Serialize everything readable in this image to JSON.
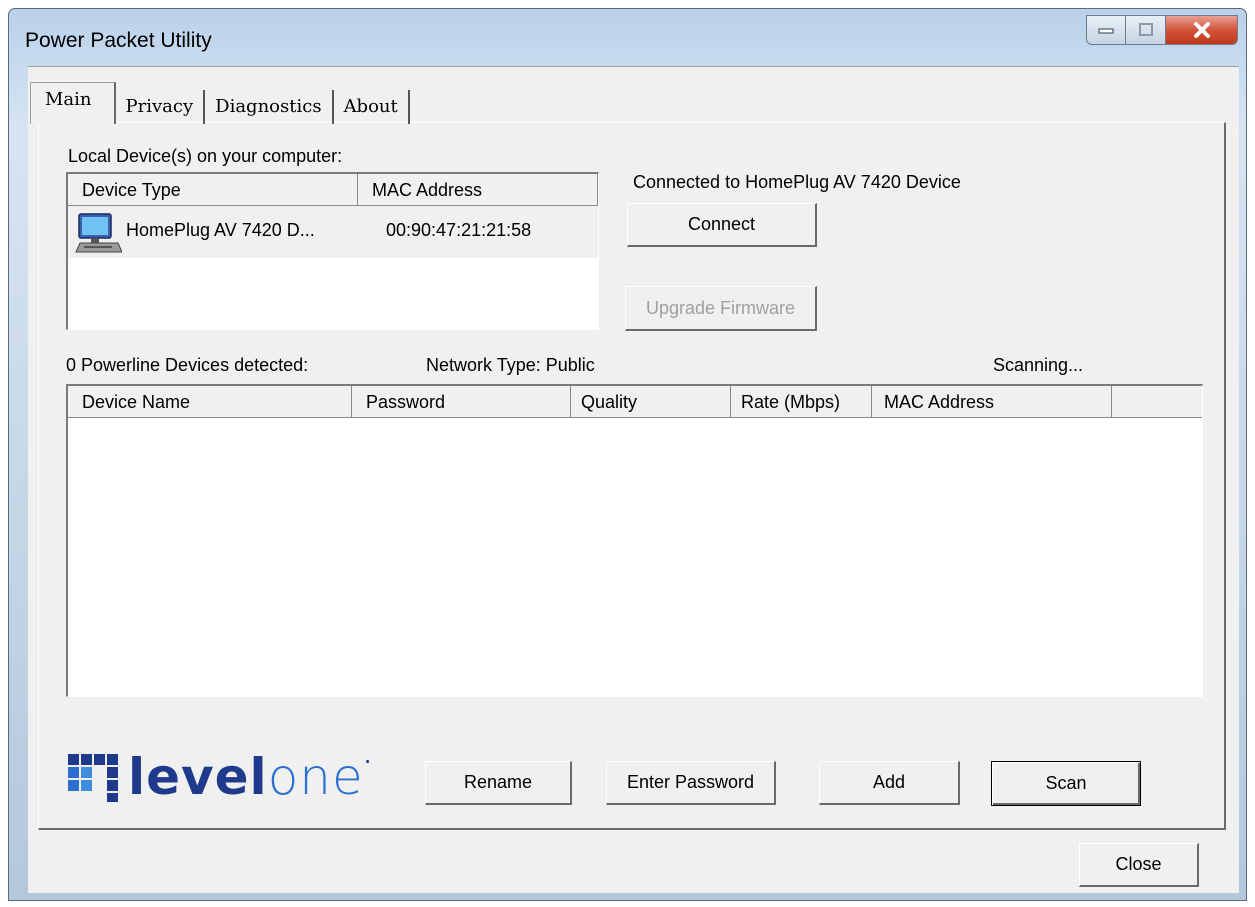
{
  "window": {
    "title": "Power Packet Utility"
  },
  "caption": {
    "minimize": "minimize",
    "maximize": "maximize",
    "close": "close"
  },
  "tabs": [
    {
      "label": "Main",
      "active": true
    },
    {
      "label": "Privacy",
      "active": false
    },
    {
      "label": "Diagnostics",
      "active": false
    },
    {
      "label": "About",
      "active": false
    }
  ],
  "local": {
    "section_label": "Local Device(s) on your computer:",
    "columns": [
      "Device Type",
      "MAC Address"
    ],
    "rows": [
      {
        "icon": "computer-icon",
        "device_type": "HomePlug AV 7420 D...",
        "mac": "00:90:47:21:21:58"
      }
    ]
  },
  "connection": {
    "status": "Connected to HomePlug AV 7420 Device",
    "connect_label": "Connect",
    "upgrade_label": "Upgrade Firmware"
  },
  "powerline": {
    "detected": "0 Powerline Devices detected:",
    "network_type": "Network Type: Public",
    "scanning": "Scanning...",
    "columns": [
      "Device Name",
      "Password",
      "Quality",
      "Rate (Mbps)",
      "MAC Address"
    ],
    "rows": []
  },
  "logo": {
    "text_dark": "level",
    "text_light": "one",
    "trademark": "·"
  },
  "actions": {
    "rename": "Rename",
    "enter_password": "Enter Password",
    "add": "Add",
    "scan": "Scan",
    "close": "Close"
  },
  "colors": {
    "logo_dark": "#1f3a8c",
    "logo_light": "#2c6fcf",
    "close_button": "#c1381c"
  }
}
